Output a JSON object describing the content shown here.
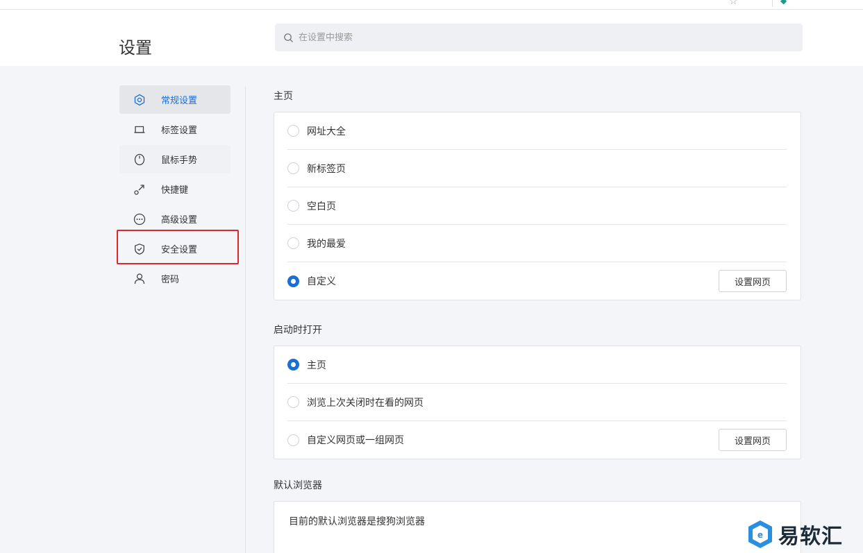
{
  "page_title": "设置",
  "search": {
    "placeholder": "在设置中搜索",
    "value": ""
  },
  "sidebar": {
    "items": [
      {
        "label": "常规设置",
        "icon": "hexagon-gear-icon",
        "active": true
      },
      {
        "label": "标签设置",
        "icon": "tab-icon"
      },
      {
        "label": "鼠标手势",
        "icon": "mouse-icon"
      },
      {
        "label": "快捷键",
        "icon": "shortcut-icon"
      },
      {
        "label": "高级设置",
        "icon": "more-dots-icon"
      },
      {
        "label": "安全设置",
        "icon": "shield-icon",
        "highlighted": true
      },
      {
        "label": "密码",
        "icon": "person-icon"
      }
    ]
  },
  "sections": {
    "homepage": {
      "title": "主页",
      "options": [
        "网址大全",
        "新标签页",
        "空白页",
        "我的最爱",
        "自定义"
      ],
      "selected": "自定义",
      "button": "设置网页"
    },
    "startup": {
      "title": "启动时打开",
      "options": [
        "主页",
        "浏览上次关闭时在看的网页",
        "自定义网页或一组网页"
      ],
      "selected": "主页",
      "button": "设置网页"
    },
    "default_browser": {
      "title": "默认浏览器",
      "text": "目前的默认浏览器是搜狗浏览器"
    }
  },
  "watermark": {
    "text": "易软汇"
  },
  "colors": {
    "accent": "#1b6fd0",
    "highlight": "#e0262a",
    "background": "#f4f5f9"
  }
}
